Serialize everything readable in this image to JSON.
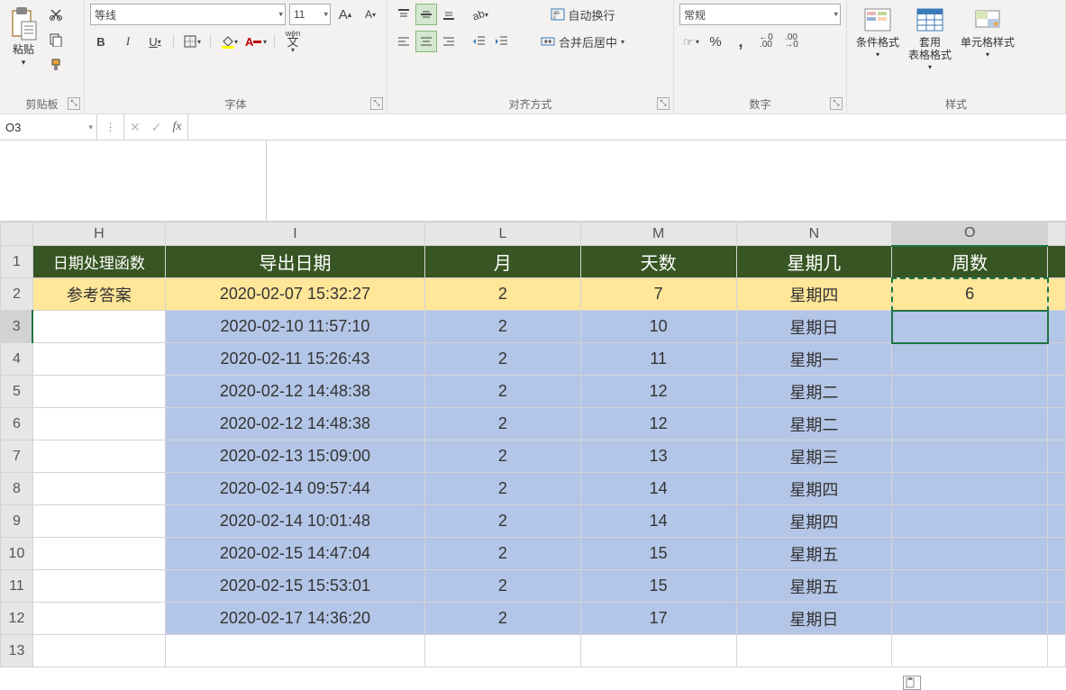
{
  "ribbon": {
    "clipboard": {
      "paste": "粘贴",
      "label": "剪贴板"
    },
    "font": {
      "name": "等线",
      "size": "11",
      "bold": "B",
      "italic": "I",
      "underline": "U",
      "pinyin": "wén",
      "label": "字体"
    },
    "alignment": {
      "wrap": "自动换行",
      "merge": "合并后居中",
      "label": "对齐方式"
    },
    "number": {
      "format": "常规",
      "pct": "%",
      "comma": ",",
      "inc": ".00",
      "dec": ".0",
      "label": "数字"
    },
    "styles": {
      "cond": "条件格式",
      "tbl": "套用\n表格格式",
      "cell": "单元格样式",
      "label": "样式"
    }
  },
  "namebox": "O3",
  "formula": "",
  "columns": [
    "H",
    "I",
    "L",
    "M",
    "N",
    "O"
  ],
  "headerRow": {
    "H": "日期处理函数",
    "I": "导出日期",
    "L": "月",
    "M": "天数",
    "N": "星期几",
    "O": "周数"
  },
  "rows": [
    {
      "n": 2,
      "cls": "yellowrow",
      "H": "参考答案",
      "I": "2020-02-07 15:32:27",
      "L": "2",
      "M": "7",
      "N": "星期四",
      "O": "6"
    },
    {
      "n": 3,
      "cls": "bluerow",
      "H": "",
      "I": "2020-02-10 11:57:10",
      "L": "2",
      "M": "10",
      "N": "星期日",
      "O": ""
    },
    {
      "n": 4,
      "cls": "bluerow",
      "H": "",
      "I": "2020-02-11 15:26:43",
      "L": "2",
      "M": "11",
      "N": "星期一",
      "O": ""
    },
    {
      "n": 5,
      "cls": "bluerow",
      "H": "",
      "I": "2020-02-12 14:48:38",
      "L": "2",
      "M": "12",
      "N": "星期二",
      "O": ""
    },
    {
      "n": 6,
      "cls": "bluerow",
      "H": "",
      "I": "2020-02-12 14:48:38",
      "L": "2",
      "M": "12",
      "N": "星期二",
      "O": ""
    },
    {
      "n": 7,
      "cls": "bluerow",
      "H": "",
      "I": "2020-02-13 15:09:00",
      "L": "2",
      "M": "13",
      "N": "星期三",
      "O": ""
    },
    {
      "n": 8,
      "cls": "bluerow",
      "H": "",
      "I": "2020-02-14 09:57:44",
      "L": "2",
      "M": "14",
      "N": "星期四",
      "O": ""
    },
    {
      "n": 9,
      "cls": "bluerow",
      "H": "",
      "I": "2020-02-14 10:01:48",
      "L": "2",
      "M": "14",
      "N": "星期四",
      "O": ""
    },
    {
      "n": 10,
      "cls": "bluerow",
      "H": "",
      "I": "2020-02-15 14:47:04",
      "L": "2",
      "M": "15",
      "N": "星期五",
      "O": ""
    },
    {
      "n": 11,
      "cls": "bluerow",
      "H": "",
      "I": "2020-02-15 15:53:01",
      "L": "2",
      "M": "15",
      "N": "星期五",
      "O": ""
    },
    {
      "n": 12,
      "cls": "bluerow",
      "H": "",
      "I": "2020-02-17 14:36:20",
      "L": "2",
      "M": "17",
      "N": "星期日",
      "O": ""
    }
  ],
  "emptyRows": [
    13
  ],
  "selectedCell": "O3",
  "marchingRange": "O2"
}
